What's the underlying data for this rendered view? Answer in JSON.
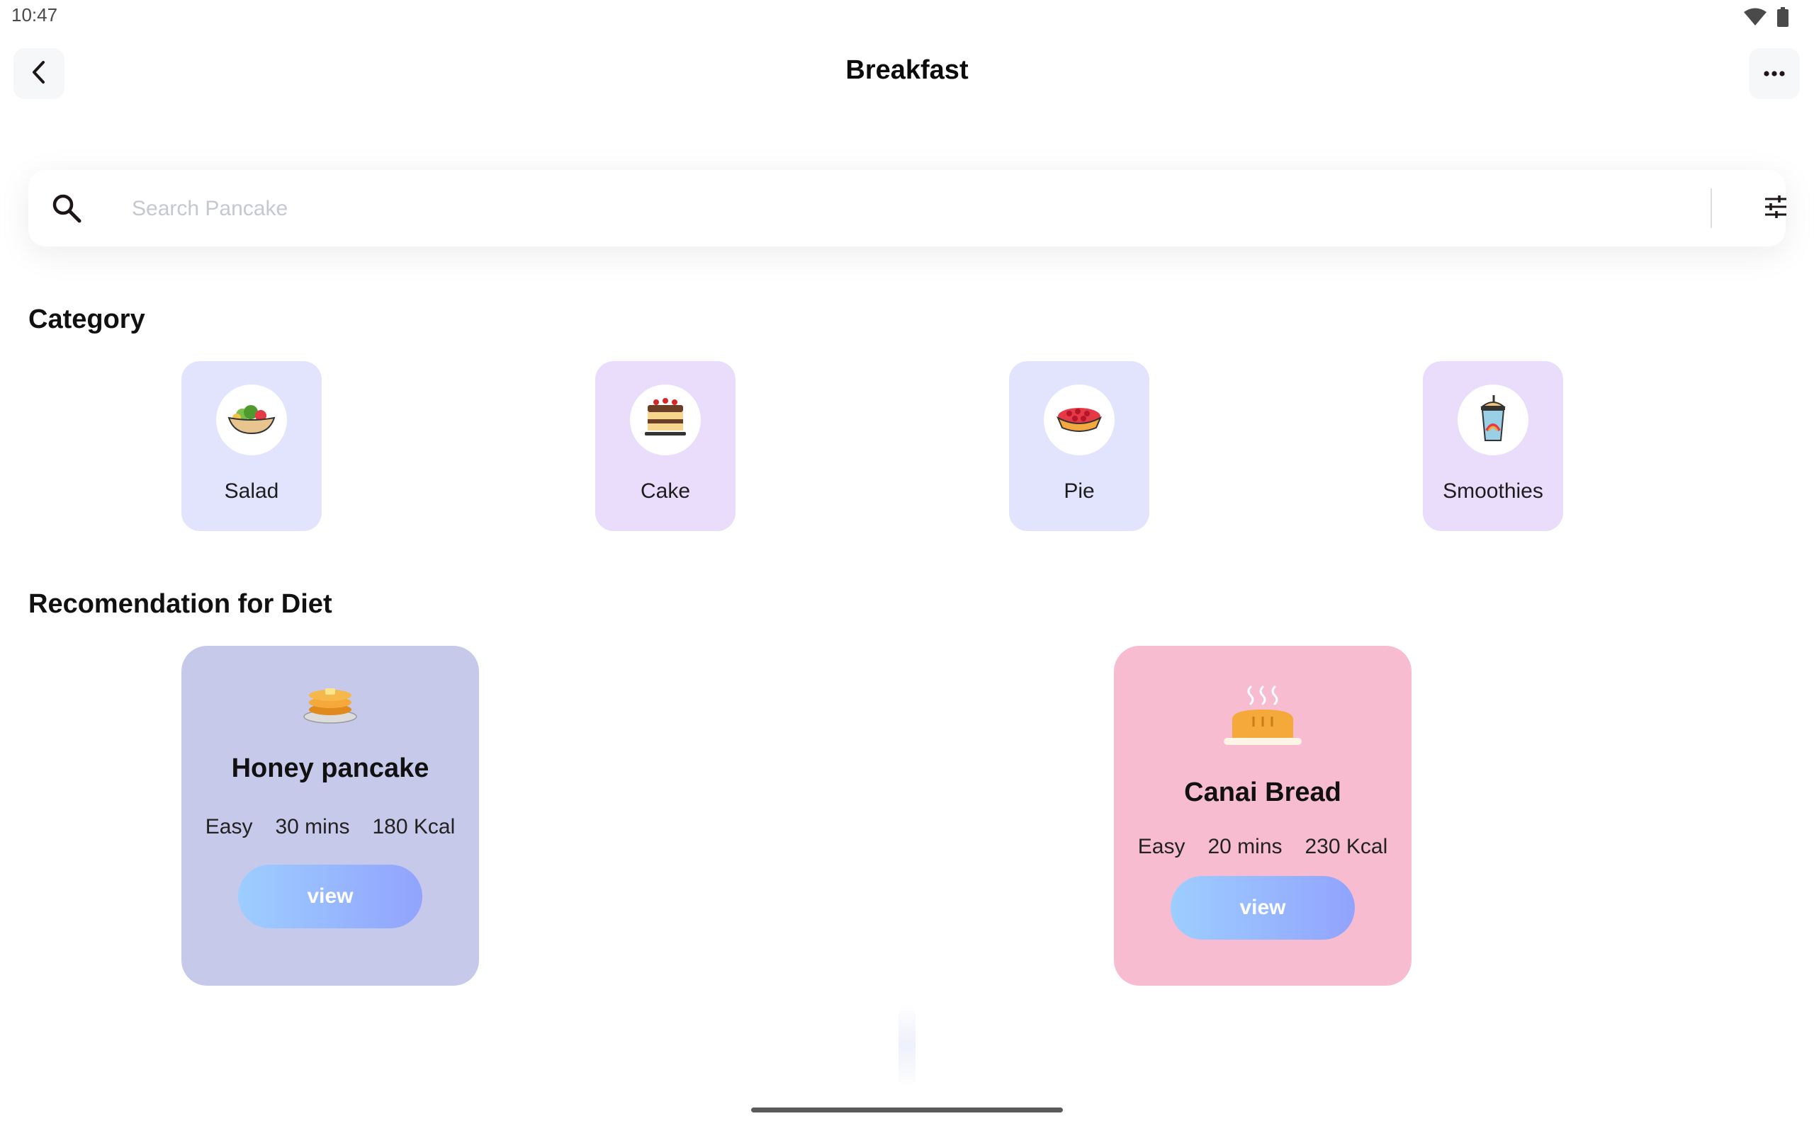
{
  "status_bar": {
    "time": "10:47",
    "icons": [
      "wifi-icon",
      "battery-icon"
    ]
  },
  "header": {
    "title": "Breakfast",
    "back_icon": "chevron-left-icon",
    "more_icon": "more-horizontal-icon"
  },
  "search": {
    "placeholder": "Search Pancake",
    "value": "",
    "icon": "search-icon",
    "filter_icon": "filter-sliders-icon"
  },
  "category": {
    "title": "Category",
    "items": [
      {
        "label": "Salad",
        "icon": "salad-bowl-icon",
        "bg": "#e2e4fe"
      },
      {
        "label": "Cake",
        "icon": "layer-cake-icon",
        "bg": "#eadcfb"
      },
      {
        "label": "Pie",
        "icon": "cherry-pie-icon",
        "bg": "#e2e4fe"
      },
      {
        "label": "Smoothies",
        "icon": "smoothie-cup-icon",
        "bg": "#eadcfb"
      }
    ]
  },
  "recommendation": {
    "title": "Recomendation for Diet",
    "items": [
      {
        "name": "Honey pancake",
        "difficulty": "Easy",
        "time": "30 mins",
        "calories": "180 Kcal",
        "button": "view",
        "icon": "pancake-icon",
        "bg": "#c6c9ea"
      },
      {
        "name": "Canai Bread",
        "difficulty": "Easy",
        "time": "20 mins",
        "calories": "230 Kcal",
        "button": "view",
        "icon": "bread-icon",
        "bg": "#f7bcd0"
      }
    ]
  },
  "colors": {
    "accent_gradient_start": "#9dceff",
    "accent_gradient_end": "#92a3fd"
  }
}
